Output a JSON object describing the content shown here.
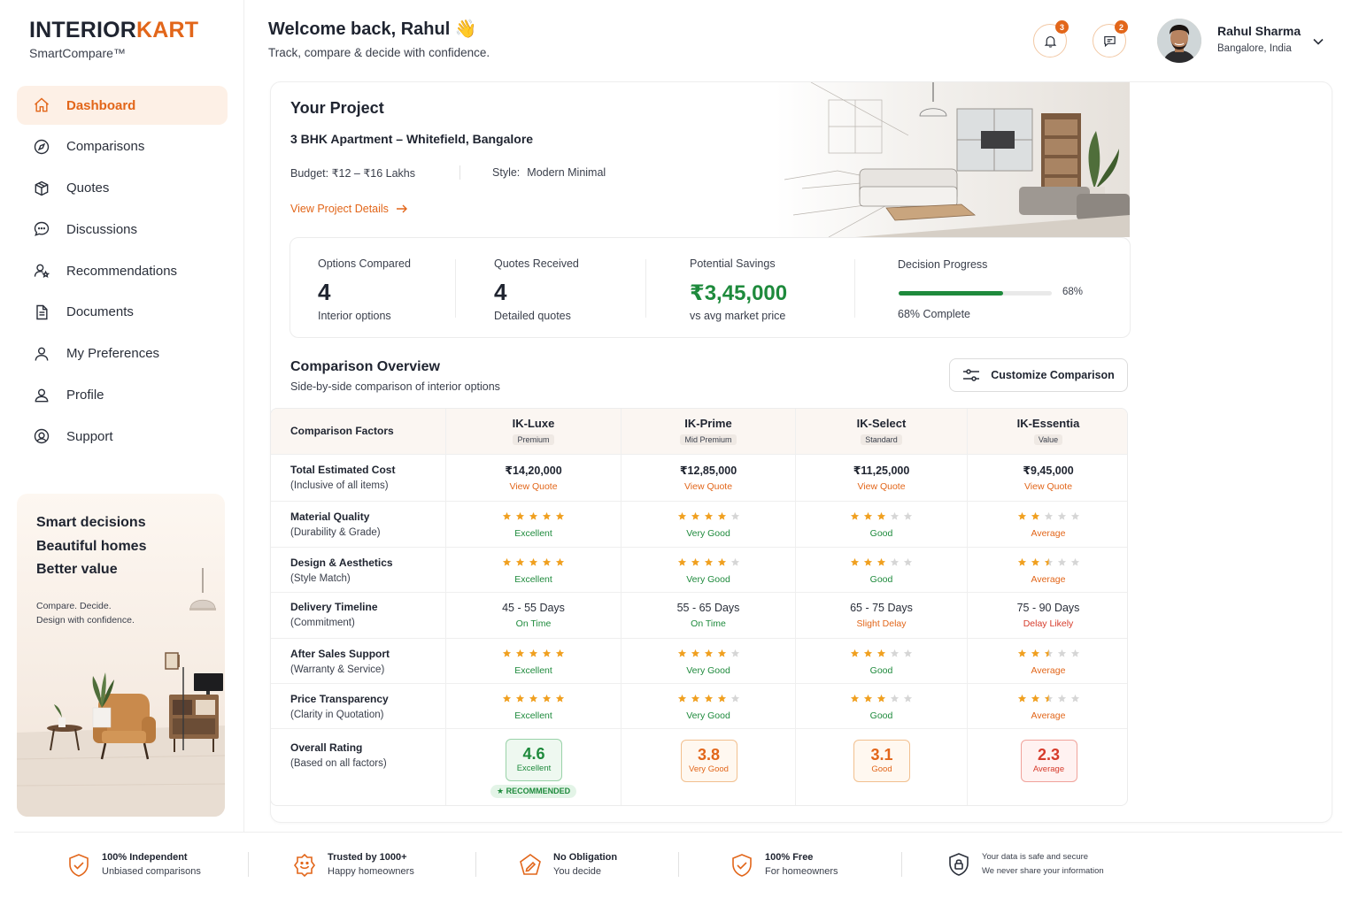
{
  "brand": {
    "name_a": "INTERIOR",
    "name_b": "KART",
    "sub": "SmartCompare™",
    "accent": "#e2661a"
  },
  "nav": [
    {
      "label": "Dashboard",
      "icon": "home-icon",
      "active": true
    },
    {
      "label": "Comparisons",
      "icon": "compass-icon"
    },
    {
      "label": "Quotes",
      "icon": "box-icon"
    },
    {
      "label": "Discussions",
      "icon": "chat-bubble-icon"
    },
    {
      "label": "Recommendations",
      "icon": "user-star-icon"
    },
    {
      "label": "Documents",
      "icon": "document-icon"
    },
    {
      "label": "My Preferences",
      "icon": "person-icon"
    },
    {
      "label": "Profile",
      "icon": "profile-icon"
    },
    {
      "label": "Support",
      "icon": "support-icon"
    }
  ],
  "promo": {
    "line1": "Smart decisions",
    "line2": "Beautiful homes",
    "line3": "Better value",
    "sub1": "Compare. Decide.",
    "sub2": "Design with confidence."
  },
  "header": {
    "greeting": "Welcome back, Rahul 👋",
    "tagline": "Track, compare & decide with confidence.",
    "notif_count": "3",
    "msg_count": "2",
    "user_name": "Rahul Sharma",
    "user_location": "Bangalore, India"
  },
  "project": {
    "title": "Your Project",
    "name": "3 BHK Apartment – Whitefield, Bangalore",
    "budget": "Budget: ₹12 – ₹16 Lakhs",
    "style_label": "Style:",
    "style_value": "Modern Minimal",
    "link": "View Project Details"
  },
  "stats": {
    "options_label": "Options Compared",
    "options_value": "4",
    "options_sub": "Interior options",
    "quotes_label": "Quotes Received",
    "quotes_value": "4",
    "quotes_sub": "Detailed quotes",
    "savings_label": "Potential Savings",
    "savings_value": "₹3,45,000",
    "savings_sub": "vs avg market price",
    "progress_label": "Decision Progress",
    "progress_pct": "68%",
    "progress_fraction": 0.68,
    "progress_sub": "68% Complete"
  },
  "comparison": {
    "title": "Comparison Overview",
    "subtitle": "Side-by-side comparison of interior options",
    "customize_label": "Customize Comparison",
    "factor_header": "Comparison Factors",
    "columns": [
      {
        "name": "IK-Luxe",
        "tier": "Premium"
      },
      {
        "name": "IK-Prime",
        "tier": "Mid Premium"
      },
      {
        "name": "IK-Select",
        "tier": "Standard"
      },
      {
        "name": "IK-Essentia",
        "tier": "Value"
      }
    ],
    "cost": {
      "label": "Total Estimated Cost",
      "sub": "(Inclusive of all items)",
      "values": [
        "₹14,20,000",
        "₹12,85,000",
        "₹11,25,000",
        "₹9,45,000"
      ],
      "link": "View Quote"
    },
    "ratings": [
      {
        "label": "Material Quality",
        "sub": "(Durability & Grade)",
        "stars": [
          5,
          4,
          3,
          2
        ],
        "words": [
          "Excellent",
          "Very Good",
          "Good",
          "Average"
        ]
      },
      {
        "label": "Design & Aesthetics",
        "sub": "(Style Match)",
        "stars": [
          5,
          4,
          3,
          2.5
        ],
        "words": [
          "Excellent",
          "Very Good",
          "Good",
          "Average"
        ]
      }
    ],
    "delivery": {
      "label": "Delivery Timeline",
      "sub": "(Commitment)",
      "values": [
        "45 - 55 Days",
        "55 - 65 Days",
        "65 - 75 Days",
        "75 - 90 Days"
      ],
      "status": [
        "On Time",
        "On Time",
        "Slight Delay",
        "Delay Likely"
      ]
    },
    "ratings2": [
      {
        "label": "After Sales Support",
        "sub": "(Warranty & Service)",
        "stars": [
          5,
          4,
          3,
          2.5
        ],
        "words": [
          "Excellent",
          "Very Good",
          "Good",
          "Average"
        ]
      },
      {
        "label": "Price Transparency",
        "sub": "(Clarity in Quotation)",
        "stars": [
          5,
          4,
          3,
          2.5
        ],
        "words": [
          "Excellent",
          "Very Good",
          "Good",
          "Average"
        ]
      }
    ],
    "overall": {
      "label": "Overall Rating",
      "sub": "(Based on all factors)",
      "scores": [
        "4.6",
        "3.8",
        "3.1",
        "2.3"
      ],
      "words": [
        "Excellent",
        "Very Good",
        "Good",
        "Average"
      ],
      "recommended": "★ RECOMMENDED"
    },
    "colors": {
      "star": "#f0a020",
      "star_empty": "#d6d6d6",
      "green": "#1e8a3c",
      "orange": "#e2661a",
      "red": "#d63b2b"
    }
  },
  "footer": [
    {
      "title": "100% Independent",
      "sub": "Unbiased comparisons",
      "icon": "shield-check-icon"
    },
    {
      "title": "Trusted by 1000+",
      "sub": "Happy homeowners",
      "icon": "smile-badge-icon"
    },
    {
      "title": "No Obligation",
      "sub": "You decide",
      "icon": "pen-badge-icon"
    },
    {
      "title": "100% Free",
      "sub": "For homeowners",
      "icon": "shield-check-icon"
    },
    {
      "title": "Your data is safe and secure",
      "sub": "We never share your information",
      "icon": "lock-shield-icon"
    }
  ]
}
